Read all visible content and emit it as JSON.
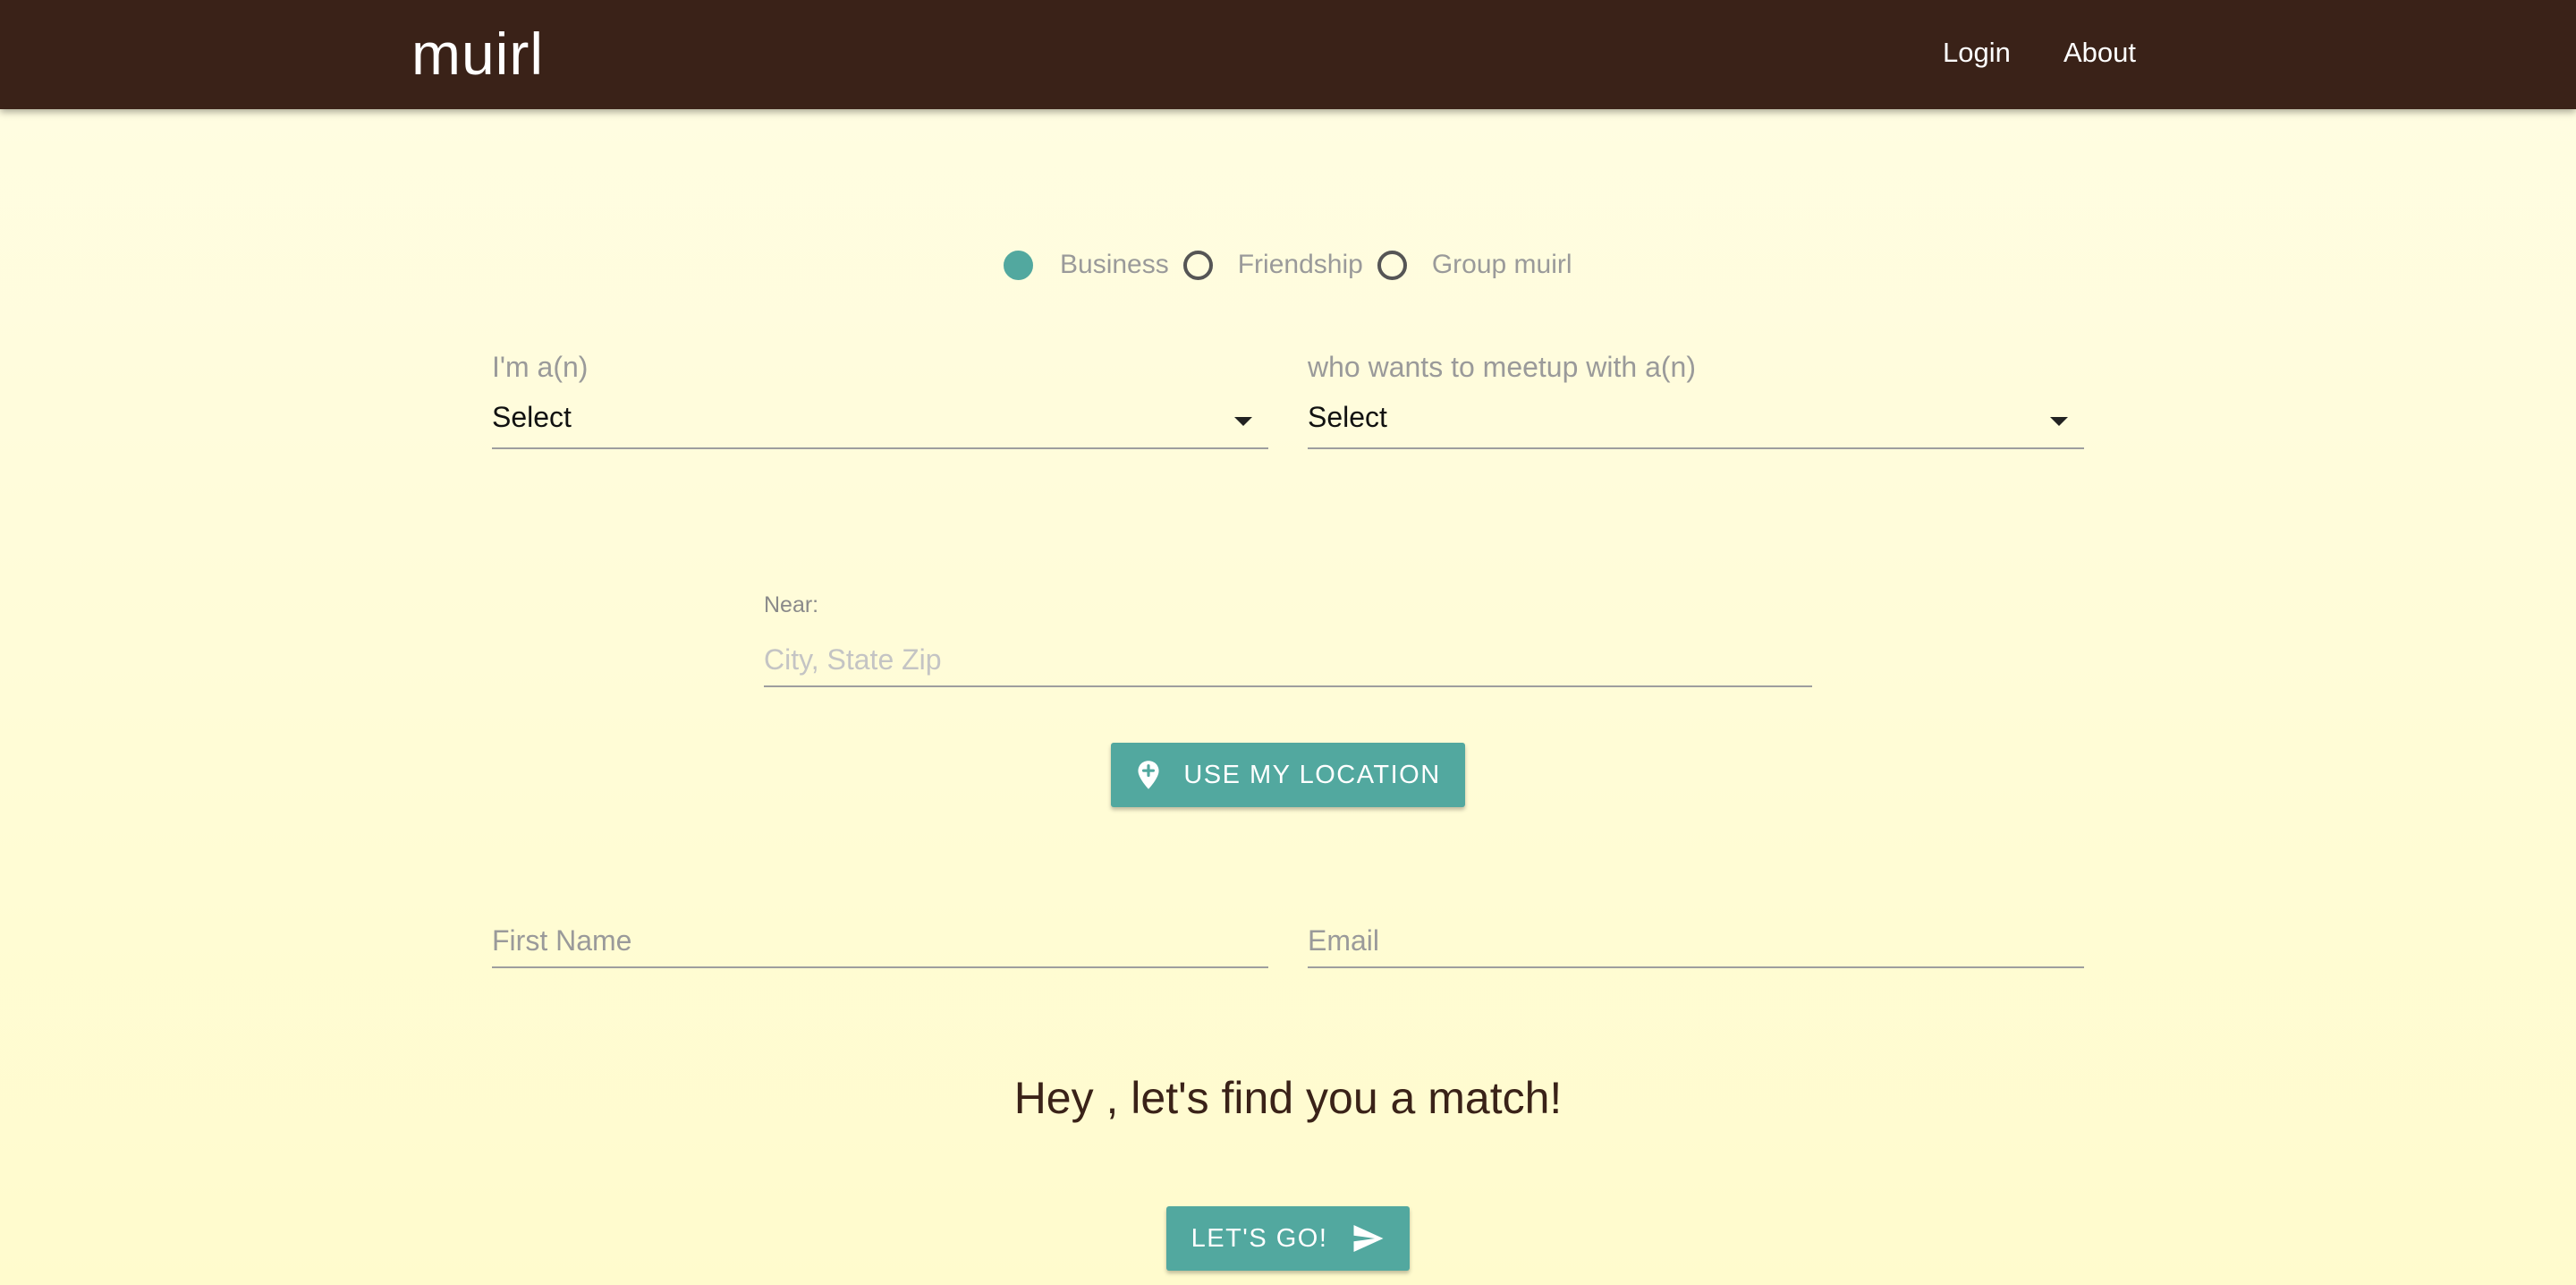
{
  "app": {
    "brand": "muirl"
  },
  "nav": {
    "login": "Login",
    "about": "About"
  },
  "meetup_type": {
    "options": [
      "Business",
      "Friendship",
      "Group muirl"
    ],
    "selected": "Business"
  },
  "form": {
    "role": {
      "label": "I'm a(n)",
      "value": "Select"
    },
    "target": {
      "label": "who wants to meetup with a(n)",
      "value": "Select"
    },
    "near": {
      "label": "Near:",
      "placeholder": "City, State Zip"
    },
    "first_name": {
      "placeholder": "First Name"
    },
    "email": {
      "placeholder": "Email"
    }
  },
  "buttons": {
    "use_location": "USE MY LOCATION",
    "lets_go": "LET'S GO!"
  },
  "headline": "Hey , let's find you a match!",
  "colors": {
    "header_bg": "#3a2218",
    "accent": "#52a89f",
    "page_bg": "#fffde3"
  },
  "icons": {
    "use_location": "add-location-pin-icon",
    "lets_go": "send-icon"
  }
}
